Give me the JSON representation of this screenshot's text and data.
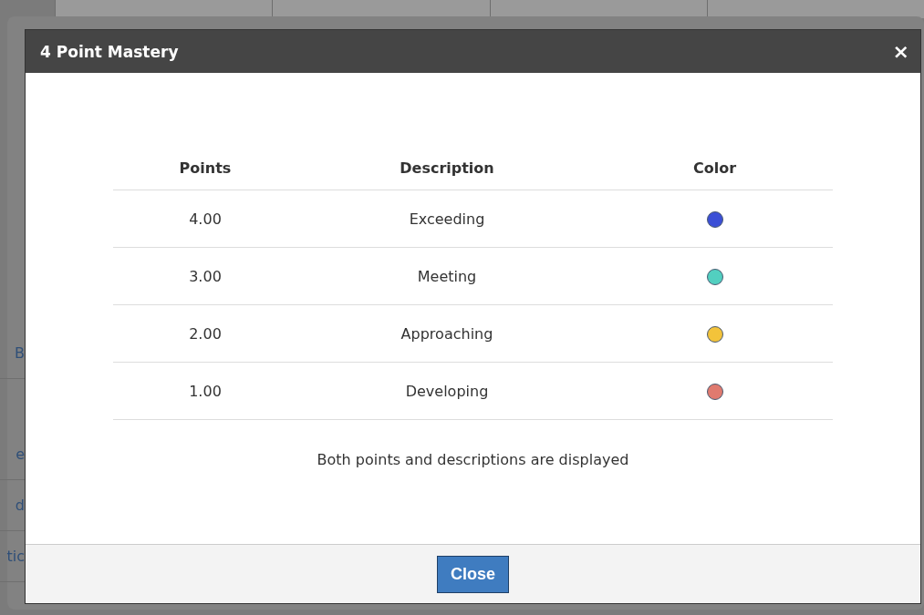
{
  "background_fragments": [
    "B",
    "e",
    "d",
    "tic"
  ],
  "dialog": {
    "title": "4 Point Mastery",
    "close_icon": "×",
    "table": {
      "columns": [
        "Points",
        "Description",
        "Color"
      ],
      "rows": [
        {
          "points": "4.00",
          "description": "Exceeding",
          "color": "#3b4fd6"
        },
        {
          "points": "3.00",
          "description": "Meeting",
          "color": "#52cfc0"
        },
        {
          "points": "2.00",
          "description": "Approaching",
          "color": "#f3c33a"
        },
        {
          "points": "1.00",
          "description": "Developing",
          "color": "#e07a6f"
        }
      ]
    },
    "note": "Both points and descriptions are displayed",
    "buttons": [
      "Close"
    ]
  }
}
